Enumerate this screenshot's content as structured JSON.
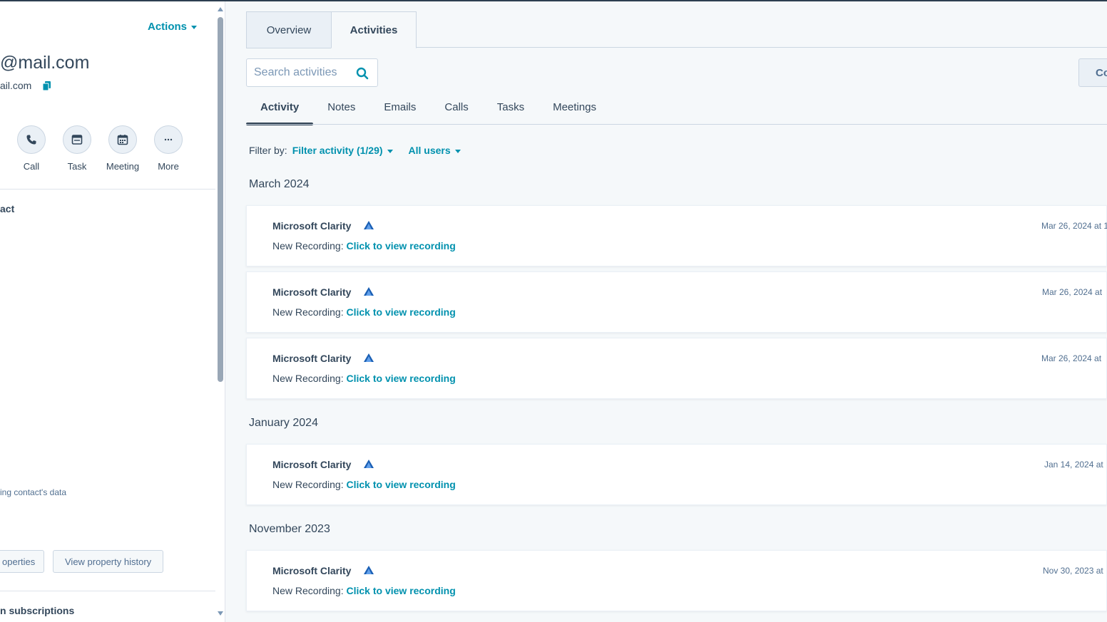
{
  "sidebar": {
    "actions_label": "Actions",
    "email_title": "@mail.com",
    "email_sub": "ail.com",
    "quick_actions": [
      {
        "label": "Call"
      },
      {
        "label": "Task"
      },
      {
        "label": "Meeting"
      },
      {
        "label": "More"
      }
    ],
    "section_heading": "act",
    "data_note": "ing contact's data",
    "button_properties": "operties",
    "button_history": "View property history",
    "section_heading_2": "n subscriptions"
  },
  "main": {
    "tabs": [
      {
        "label": "Overview"
      },
      {
        "label": "Activities"
      }
    ],
    "search": {
      "placeholder": "Search activities"
    },
    "collapse_button": "Co",
    "subtabs": [
      {
        "label": "Activity"
      },
      {
        "label": "Notes"
      },
      {
        "label": "Emails"
      },
      {
        "label": "Calls"
      },
      {
        "label": "Tasks"
      },
      {
        "label": "Meetings"
      }
    ],
    "filter": {
      "label": "Filter by:",
      "activity": "Filter activity (1/29)",
      "users": "All users"
    },
    "months": [
      "March 2024",
      "January 2024",
      "November 2023"
    ],
    "cards": [
      {
        "title": "Microsoft Clarity",
        "prefix": "New Recording:",
        "link": "Click to view recording",
        "date": "Mar 26, 2024 at 1"
      },
      {
        "title": "Microsoft Clarity",
        "prefix": "New Recording:",
        "link": "Click to view recording",
        "date": "Mar 26, 2024 at"
      },
      {
        "title": "Microsoft Clarity",
        "prefix": "New Recording:",
        "link": "Click to view recording",
        "date": "Mar 26, 2024 at"
      },
      {
        "title": "Microsoft Clarity",
        "prefix": "New Recording:",
        "link": "Click to view recording",
        "date": "Jan 14, 2024 at"
      },
      {
        "title": "Microsoft Clarity",
        "prefix": "New Recording:",
        "link": "Click to view recording",
        "date": "Nov 30, 2023 at"
      }
    ]
  },
  "colors": {
    "accent": "#0091ae",
    "text": "#33475b",
    "clarity_blue": "#1a5fb4"
  },
  "icons": [
    "copy-icon",
    "phone-icon",
    "task-icon",
    "calendar-icon",
    "ellipsis-icon",
    "search-icon",
    "clarity-logo-icon",
    "chevron-down-icon"
  ]
}
